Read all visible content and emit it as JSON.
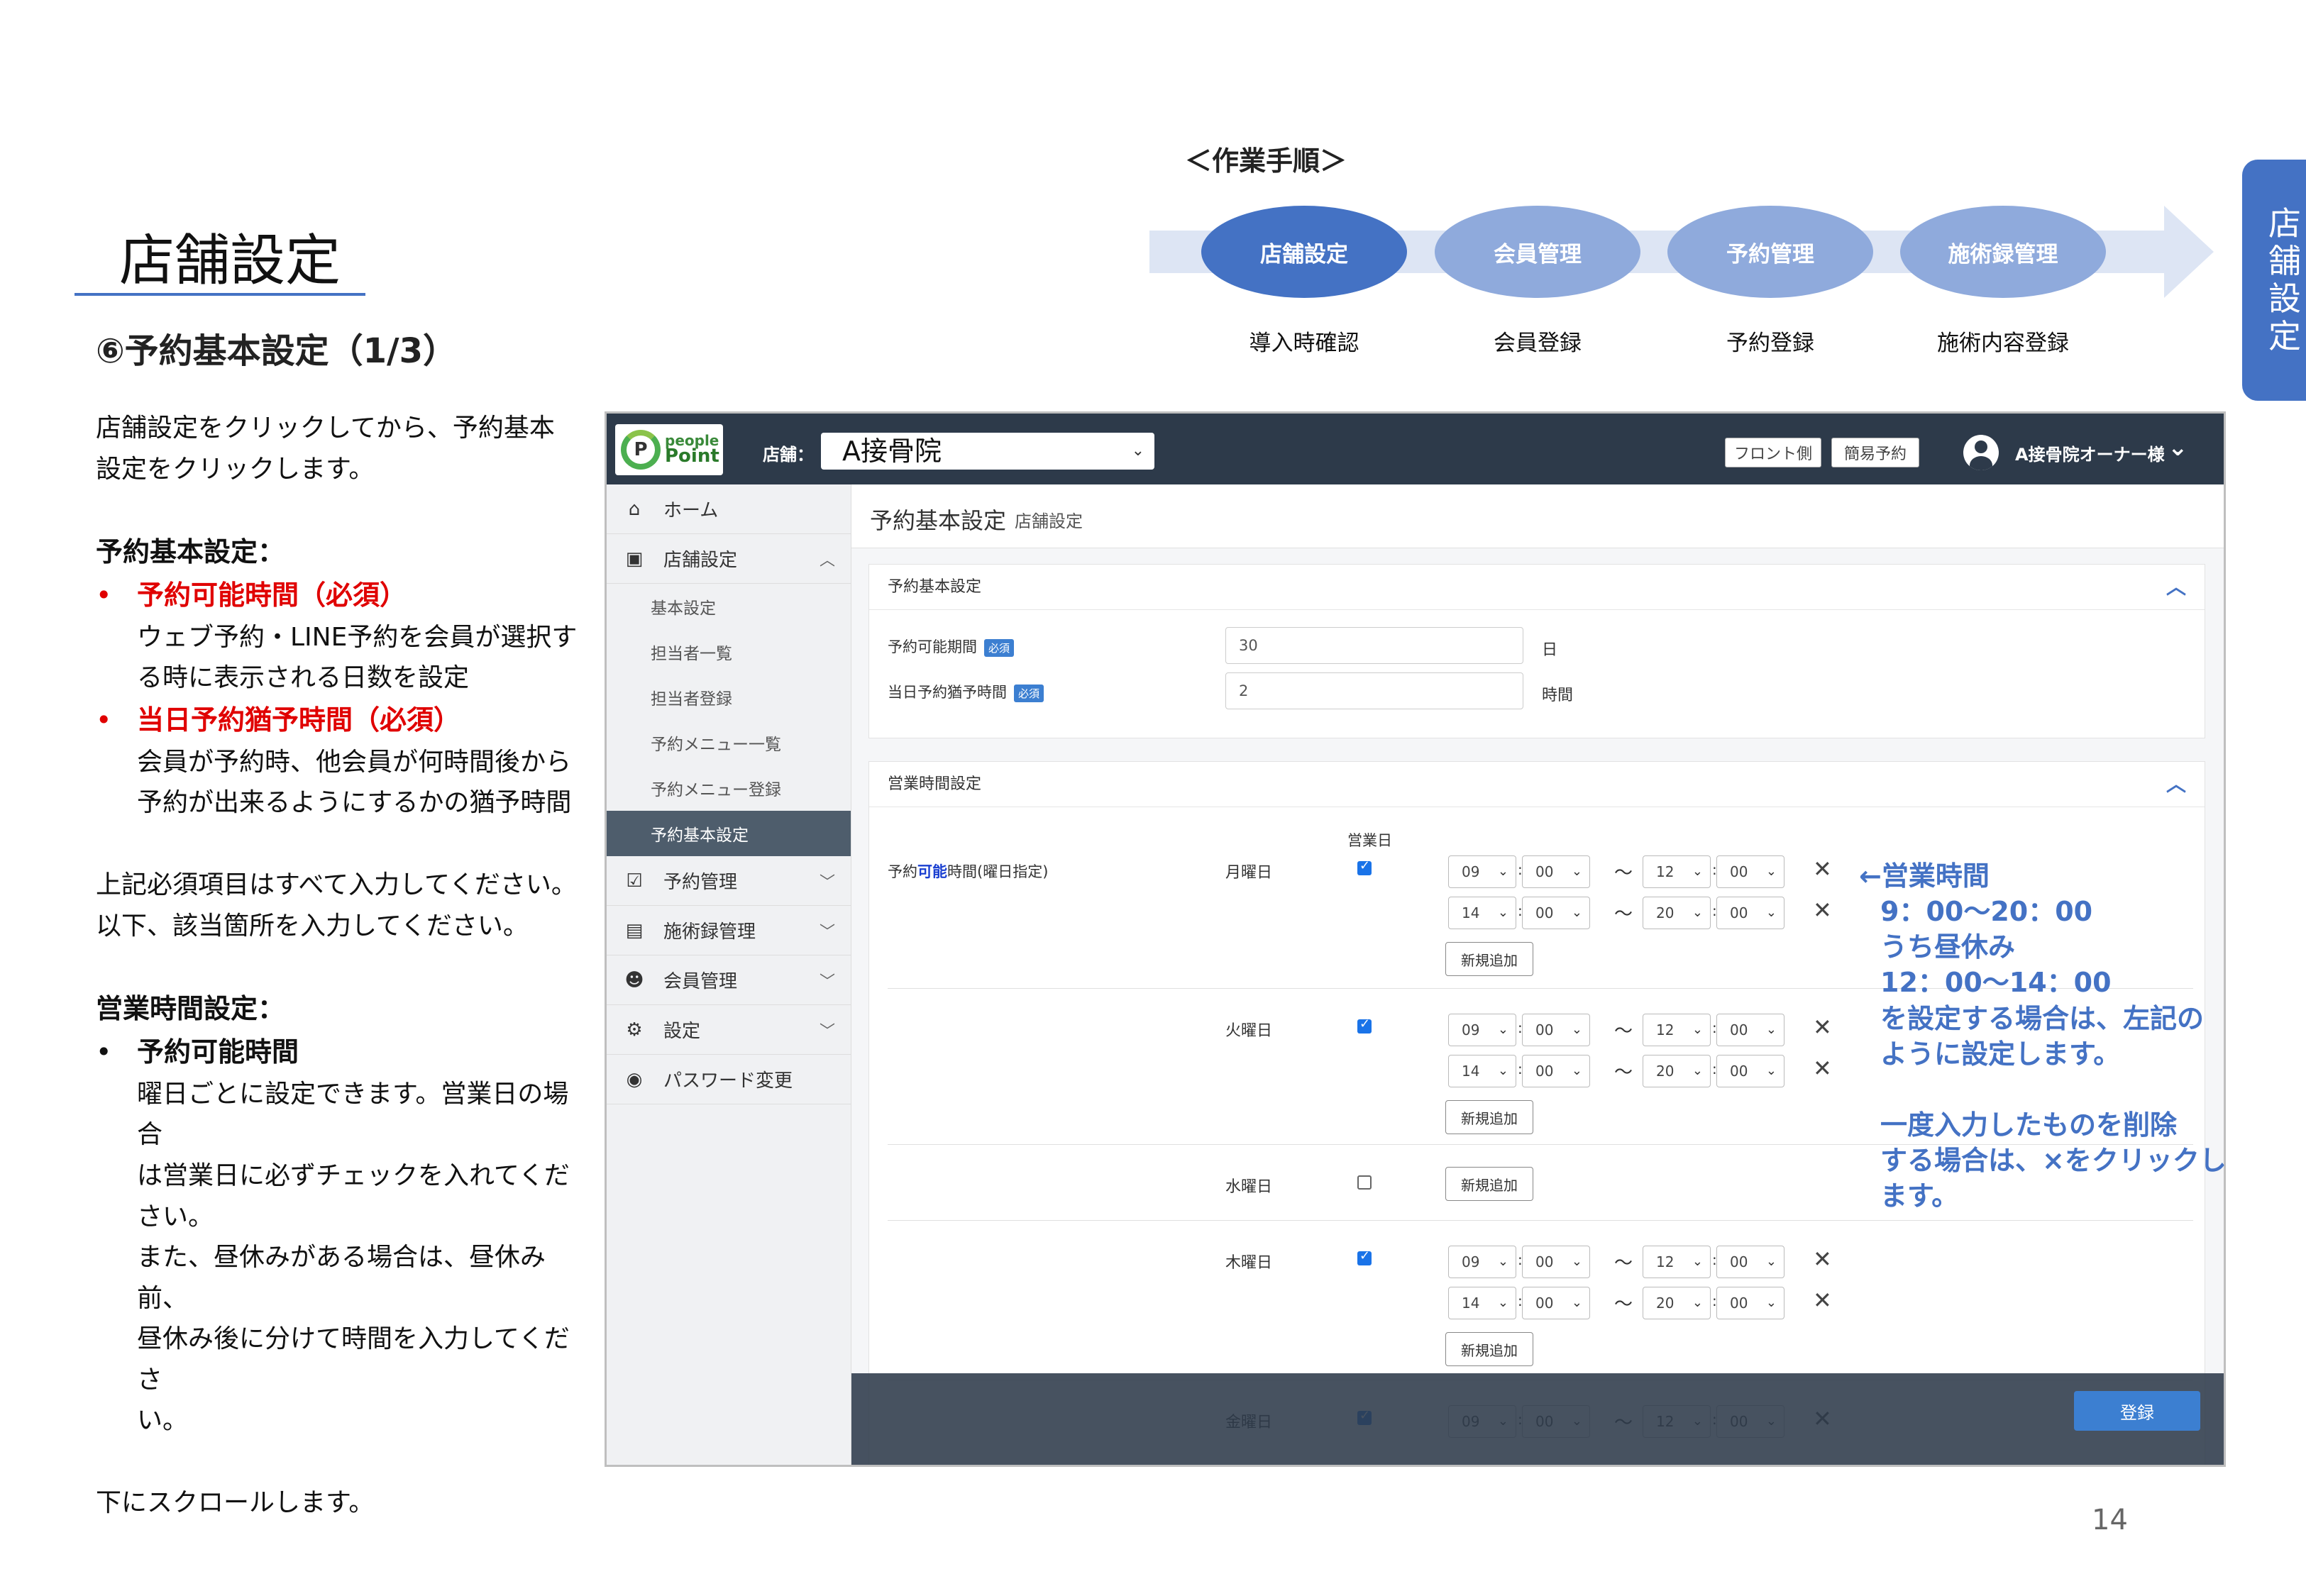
{
  "slide": {
    "title": "店舗設定",
    "section": "⑥予約基本設定（1/3）",
    "side_tab": "店舗設定",
    "page_number": "14"
  },
  "workflow": {
    "label": "＜作業手順＞",
    "steps": [
      {
        "label": "店舗設定",
        "sub": "導入時確認"
      },
      {
        "label": "会員管理",
        "sub": "会員登録"
      },
      {
        "label": "予約管理",
        "sub": "予約登録"
      },
      {
        "label": "施術録管理",
        "sub": "施術内容登録"
      }
    ],
    "active_color": "#4472c4",
    "inactive_color": "#8faadc"
  },
  "explanation": {
    "intro": [
      "店舗設定をクリックしてから、予約基本",
      "設定をクリックします。"
    ],
    "basic_heading": "予約基本設定：",
    "item1_title": "予約可能時間（必須）",
    "item1_desc": [
      "ウェブ予約・LINE予約を会員が選択す",
      "る時に表示される日数を設定"
    ],
    "item2_title": "当日予約猶予時間（必須）",
    "item2_desc": [
      "会員が予約時、他会員が何時間後から",
      "予約が出来るようにするかの猶予時間"
    ],
    "required_note": [
      "上記必須項目はすべて入力してください。",
      "以下、該当箇所を入力してください。"
    ],
    "hours_heading": "営業時間設定：",
    "item3_title": "予約可能時間",
    "item3_desc": [
      "曜日ごとに設定できます。営業日の場合",
      "は営業日に必ずチェックを入れてください。",
      "また、昼休みがある場合は、昼休み前、",
      "昼休み後に分けて時間を入力してくださ",
      "い。"
    ],
    "scroll_note": "下にスクロールします。",
    "accent_red": "#e00000"
  },
  "app": {
    "logo": {
      "line1": "people",
      "line2": "Point"
    },
    "store_label": "店舗：",
    "store_value": "A接骨院",
    "header_buttons": [
      "フロント側",
      "簡易予約"
    ],
    "user_name": "A接骨院オーナー様",
    "sidebar": {
      "home": "ホーム",
      "store_settings": "店舗設定",
      "sub_items": [
        "基本設定",
        "担当者一覧",
        "担当者登録",
        "予約メニュー一覧",
        "予約メニュー登録",
        "予約基本設定"
      ],
      "reservation": "予約管理",
      "treatment": "施術録管理",
      "members": "会員管理",
      "settings": "設定",
      "password": "パスワード変更"
    },
    "page_title": "予約基本設定",
    "page_subtitle": "店舗設定",
    "basic_card": {
      "title": "予約基本設定",
      "period_label": "予約可能期間",
      "period_value": "30",
      "period_unit": "日",
      "grace_label": "当日予約猶予時間",
      "grace_value": "2",
      "grace_unit": "時間",
      "required_badge": "必須"
    },
    "hours_card": {
      "title": "営業時間設定",
      "business_day_header": "営業日",
      "row_label_prefix": "予約",
      "row_label_highlight": "可能",
      "row_label_suffix": "時間(曜日指定)",
      "add_button": "新規追加",
      "tilde": "～",
      "colon": ":",
      "remove_symbol": "✕",
      "days": [
        {
          "name": "月曜日",
          "checked": true,
          "slots": [
            [
              "09",
              "00",
              "12",
              "00"
            ],
            [
              "14",
              "00",
              "20",
              "00"
            ]
          ]
        },
        {
          "name": "火曜日",
          "checked": true,
          "slots": [
            [
              "09",
              "00",
              "12",
              "00"
            ],
            [
              "14",
              "00",
              "20",
              "00"
            ]
          ]
        },
        {
          "name": "水曜日",
          "checked": false,
          "slots": []
        },
        {
          "name": "木曜日",
          "checked": true,
          "slots": [
            [
              "09",
              "00",
              "12",
              "00"
            ],
            [
              "14",
              "00",
              "20",
              "00"
            ]
          ]
        },
        {
          "name": "金曜日",
          "checked": true,
          "slots": [
            [
              "09",
              "00",
              "12",
              "00"
            ]
          ]
        }
      ]
    },
    "submit_button": "登録"
  },
  "annotation": {
    "lines": [
      "←営業時間",
      "9：00～20：00",
      "うち昼休み",
      "12：00～14：00",
      "を設定する場合は、左記の",
      "ように設定します。"
    ],
    "delete_lines": [
      "一度入力したものを削除",
      "する場合は、×をクリックし",
      "ます。"
    ],
    "color": "#4472c4"
  }
}
